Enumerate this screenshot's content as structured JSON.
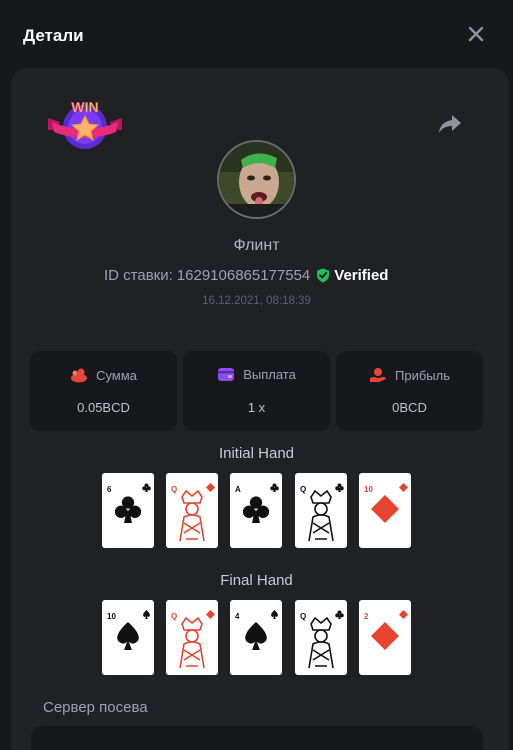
{
  "modal": {
    "title": "Детали"
  },
  "player": {
    "name": "Флинт",
    "bet_id_label": "ID ставки:",
    "bet_id": "1629106865177554",
    "verified_label": "Verified",
    "date": "16.12.2021, 08:18:39"
  },
  "badge": {
    "text": "WIN"
  },
  "stats": [
    {
      "label": "Сумма",
      "value": "0.05BCD",
      "icon": "coins-icon",
      "color": "#e8453c"
    },
    {
      "label": "Выплата",
      "value": "1 x",
      "icon": "wallet-icon",
      "color": "#8b4cf0"
    },
    {
      "label": "Прибыль",
      "value": "0BCD",
      "icon": "profit-hand-icon",
      "color": "#e8453c"
    }
  ],
  "hands": {
    "initial_label": "Initial Hand",
    "final_label": "Final Hand",
    "initial": [
      {
        "rank": "6",
        "suit": "clubs"
      },
      {
        "rank": "Q",
        "suit": "diamonds"
      },
      {
        "rank": "A",
        "suit": "clubs"
      },
      {
        "rank": "Q",
        "suit": "clubs"
      },
      {
        "rank": "10",
        "suit": "diamonds"
      }
    ],
    "final": [
      {
        "rank": "10",
        "suit": "spades"
      },
      {
        "rank": "Q",
        "suit": "diamonds"
      },
      {
        "rank": "4",
        "suit": "spades"
      },
      {
        "rank": "Q",
        "suit": "clubs"
      },
      {
        "rank": "2",
        "suit": "diamonds"
      }
    ]
  },
  "server_seed": {
    "label": "Сервер посева"
  },
  "colors": {
    "background": "#17181b",
    "panel": "#202125",
    "verified": "#20c05c",
    "red_suit": "#e6442f"
  }
}
